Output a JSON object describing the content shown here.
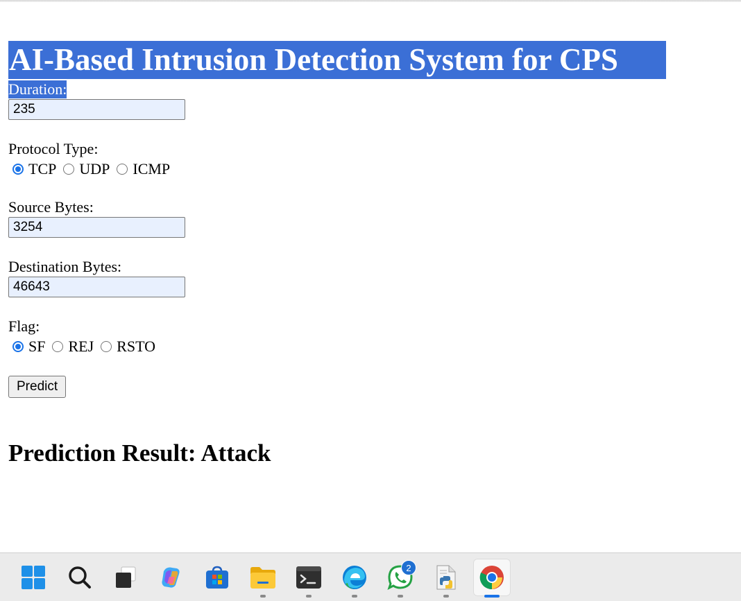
{
  "title": "AI-Based Intrusion Detection System for CPS",
  "form": {
    "duration": {
      "label": "Duration:",
      "value": "235"
    },
    "protocol": {
      "label": "Protocol Type:",
      "options": [
        "TCP",
        "UDP",
        "ICMP"
      ],
      "selected": "TCP"
    },
    "source_bytes": {
      "label": "Source Bytes:",
      "value": "3254"
    },
    "destination_bytes": {
      "label": "Destination Bytes:",
      "value": "46643"
    },
    "flag": {
      "label": "Flag:",
      "options": [
        "SF",
        "REJ",
        "RSTO"
      ],
      "selected": "SF"
    },
    "submit_label": "Predict"
  },
  "result": {
    "text": "Prediction Result: Attack"
  },
  "taskbar": {
    "items": [
      {
        "name": "windows-start-icon",
        "active": false,
        "running": false
      },
      {
        "name": "search-icon",
        "active": false,
        "running": false
      },
      {
        "name": "task-view-icon",
        "active": false,
        "running": false
      },
      {
        "name": "copilot-icon",
        "active": false,
        "running": false
      },
      {
        "name": "microsoft-store-icon",
        "active": false,
        "running": false
      },
      {
        "name": "file-explorer-icon",
        "active": false,
        "running": true
      },
      {
        "name": "terminal-icon",
        "active": false,
        "running": true
      },
      {
        "name": "edge-browser-icon",
        "active": false,
        "running": true
      },
      {
        "name": "whatsapp-icon",
        "active": false,
        "running": true,
        "badge": "2"
      },
      {
        "name": "python-file-icon",
        "active": false,
        "running": true
      },
      {
        "name": "chrome-icon",
        "active": true,
        "running": true
      }
    ],
    "colors": {
      "accent": "#1a73e8",
      "highlight": "#3b6fd6"
    }
  }
}
